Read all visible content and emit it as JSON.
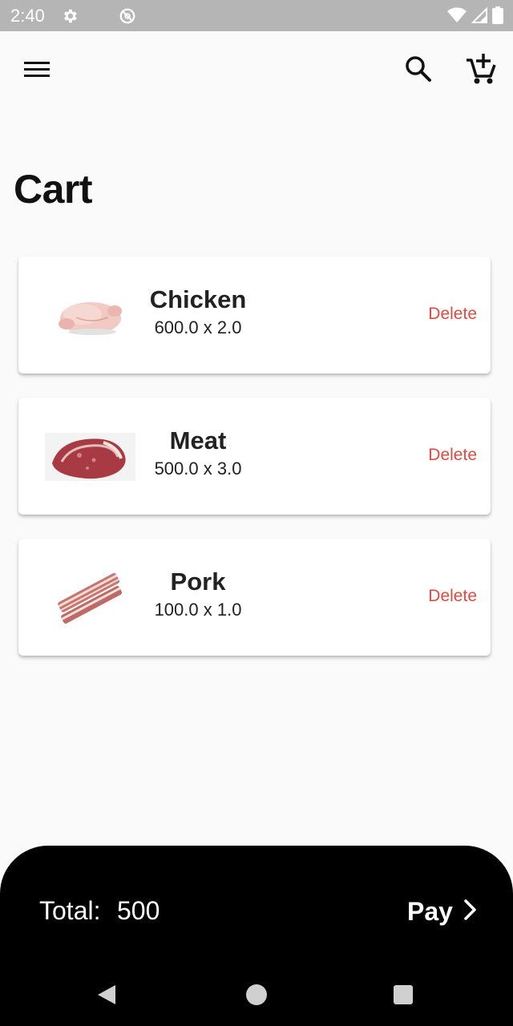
{
  "status_bar": {
    "time": "2:40",
    "left_icons": [
      "gear-icon",
      "no-sign-icon"
    ],
    "right_icons": [
      "wifi-icon",
      "signal-icon",
      "battery-icon"
    ]
  },
  "app_bar": {
    "icons": [
      "menu-icon",
      "search-icon",
      "add-to-cart-icon"
    ]
  },
  "page": {
    "title": "Cart"
  },
  "cart_items": [
    {
      "name": "Chicken",
      "quantity_text": "600.0 x 2.0",
      "delete_label": "Delete",
      "image": "chicken-image"
    },
    {
      "name": "Meat",
      "quantity_text": "500.0 x 3.0",
      "delete_label": "Delete",
      "image": "steak-image"
    },
    {
      "name": "Pork",
      "quantity_text": "100.0 x 1.0",
      "delete_label": "Delete",
      "image": "pork-belly-image"
    }
  ],
  "checkout": {
    "total_label": "Total:",
    "total_value": "500",
    "pay_label": "Pay"
  },
  "colors": {
    "status_bar": "#b5b5b5",
    "background": "#fafafa",
    "card": "#ffffff",
    "delete_red": "#e04a3f",
    "checkout_bar": "#000000"
  },
  "nav_bar": {
    "icons": [
      "back-icon",
      "home-icon",
      "recents-icon"
    ]
  }
}
